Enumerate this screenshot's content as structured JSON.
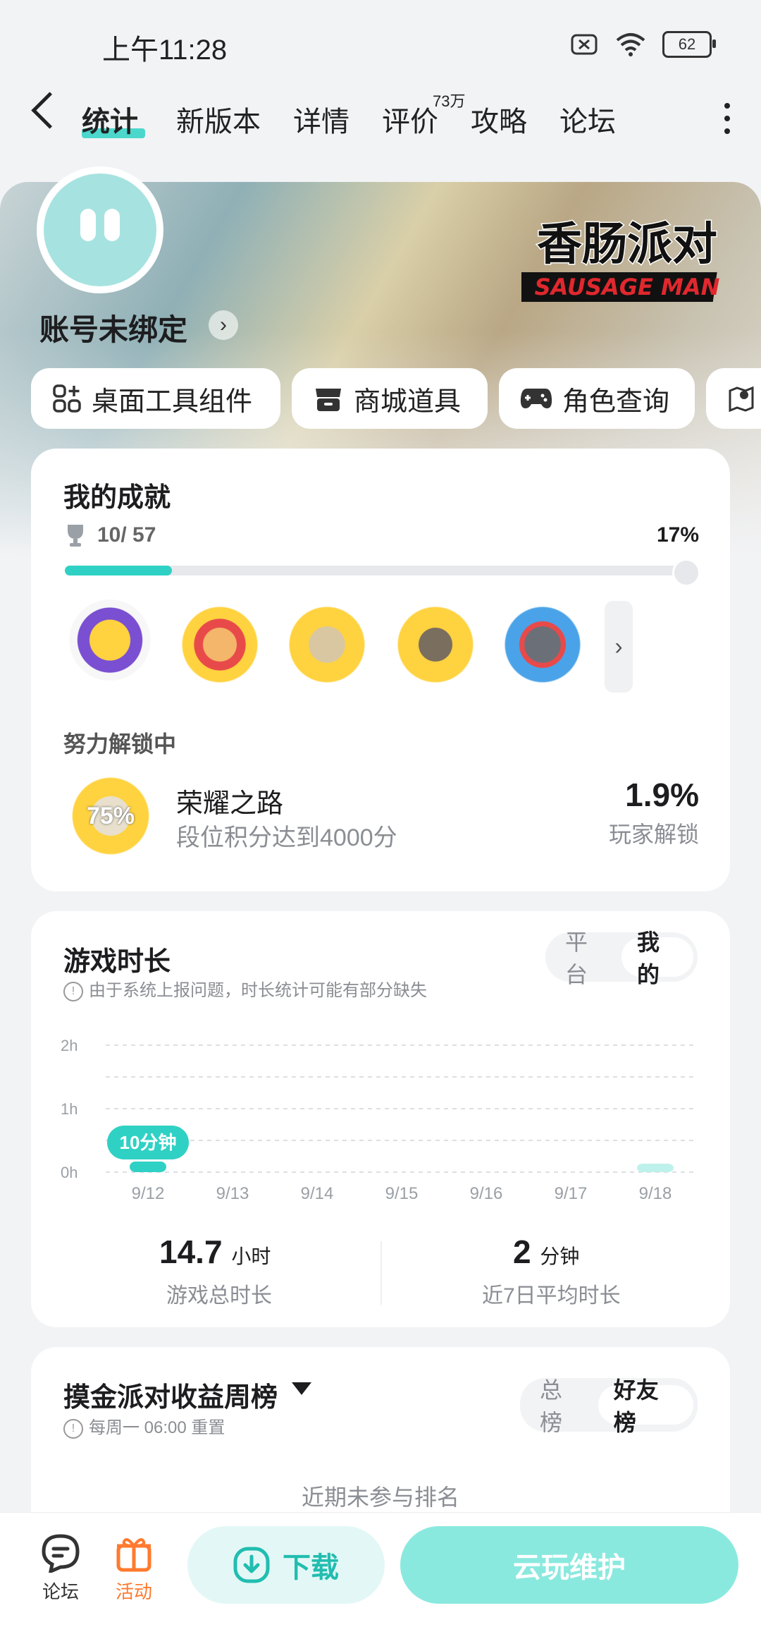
{
  "status": {
    "time": "上午11:28",
    "battery": "62"
  },
  "nav": {
    "tabs": [
      {
        "label": "统计",
        "active": true
      },
      {
        "label": "新版本"
      },
      {
        "label": "详情"
      },
      {
        "label": "评价",
        "badge": "73万"
      },
      {
        "label": "攻略"
      },
      {
        "label": "论坛"
      }
    ]
  },
  "hero": {
    "account": "账号未绑定",
    "logo_cn": "香肠派对",
    "logo_en": "SAUSAGE MAN"
  },
  "tools": [
    {
      "label": "桌面工具组件",
      "icon": "grid-plus-icon"
    },
    {
      "label": "商城道具",
      "icon": "shop-icon"
    },
    {
      "label": "角色查询",
      "icon": "gamepad-icon"
    },
    {
      "label": "",
      "icon": "map-pin-icon"
    }
  ],
  "achievements": {
    "title": "我的成就",
    "progress_text": "10/ 57",
    "percent_text": "17%",
    "progress_fraction": 0.17,
    "unlocking_label": "努力解锁中",
    "item": {
      "name": "荣耀之路",
      "desc": "段位积分达到4000分",
      "rate": "1.9%",
      "rate_label": "玩家解锁",
      "badge_text": "75%"
    }
  },
  "playtime": {
    "title": "游戏时长",
    "note": "由于系统上报问题，时长统计可能有部分缺失",
    "toggle": [
      "平台",
      "我的"
    ],
    "total_value": "14.7",
    "total_unit": "小时",
    "total_label": "游戏总时长",
    "avg_value": "2",
    "avg_unit": "分钟",
    "avg_label": "近7日平均时长",
    "tooltip": "10分钟"
  },
  "chart_data": {
    "type": "bar",
    "categories": [
      "9/12",
      "9/13",
      "9/14",
      "9/15",
      "9/16",
      "9/17",
      "9/18"
    ],
    "values_minutes": [
      10,
      0,
      0,
      0,
      0,
      0,
      2
    ],
    "y_ticks": [
      "2h",
      "1h",
      "0h"
    ],
    "ylim_hours": [
      0,
      2
    ],
    "grid": true
  },
  "ranking": {
    "title": "摸金派对收益周榜",
    "reset_note": "每周一 06:00 重置",
    "toggle": [
      "总榜",
      "好友榜"
    ],
    "empty": "近期未参与排名"
  },
  "bottom": {
    "forum": "论坛",
    "activity": "活动",
    "download": "下载",
    "cloud": "云玩维护"
  },
  "colors": {
    "accent": "#2fd1c4",
    "activity": "#ff7a2e"
  }
}
